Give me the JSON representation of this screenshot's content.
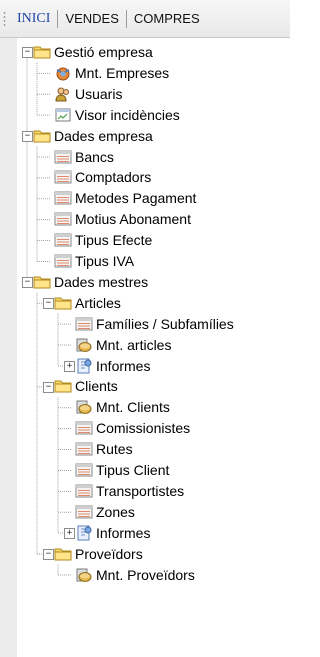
{
  "tabs": [
    {
      "label": "INICI",
      "active": true
    },
    {
      "label": "VENDES",
      "active": false
    },
    {
      "label": "COMPRES",
      "active": false
    }
  ],
  "tree": [
    {
      "label": "Gestió empresa",
      "icon": "folder-icon",
      "level": 0,
      "expander": "−"
    },
    {
      "label": "Mnt. Empreses",
      "icon": "company-icon",
      "level": 1
    },
    {
      "label": "Usuaris",
      "icon": "users-icon",
      "level": 1
    },
    {
      "label": "Visor incidències",
      "icon": "viewer-icon",
      "level": 1
    },
    {
      "label": "Dades empresa",
      "icon": "folder-icon",
      "level": 0,
      "expander": "−"
    },
    {
      "label": "Bancs",
      "icon": "list-icon",
      "level": 1
    },
    {
      "label": "Comptadors",
      "icon": "list-icon",
      "level": 1
    },
    {
      "label": "Metodes Pagament",
      "icon": "list-icon",
      "level": 1
    },
    {
      "label": "Motius Abonament",
      "icon": "list-icon",
      "level": 1
    },
    {
      "label": "Tipus Efecte",
      "icon": "list-icon",
      "level": 1
    },
    {
      "label": "Tipus IVA",
      "icon": "list-icon",
      "level": 1
    },
    {
      "label": "Dades mestres",
      "icon": "folder-icon",
      "level": 0,
      "expander": "−"
    },
    {
      "label": "Articles",
      "icon": "folder-icon",
      "level": 1,
      "expander": "−"
    },
    {
      "label": "Famílies / Subfamílies",
      "icon": "list-icon",
      "level": 2
    },
    {
      "label": "Mnt. articles",
      "icon": "database-icon",
      "level": 2
    },
    {
      "label": "Informes",
      "icon": "report-icon",
      "level": 2,
      "expander": "+"
    },
    {
      "label": "Clients",
      "icon": "folder-icon",
      "level": 1,
      "expander": "−"
    },
    {
      "label": "Mnt. Clients",
      "icon": "database-icon",
      "level": 2
    },
    {
      "label": "Comissionistes",
      "icon": "list-icon",
      "level": 2
    },
    {
      "label": "Rutes",
      "icon": "list-icon",
      "level": 2
    },
    {
      "label": "Tipus Client",
      "icon": "list-icon",
      "level": 2
    },
    {
      "label": "Transportistes",
      "icon": "list-icon",
      "level": 2
    },
    {
      "label": "Zones",
      "icon": "list-icon",
      "level": 2
    },
    {
      "label": "Informes",
      "icon": "report-icon",
      "level": 2,
      "expander": "+"
    },
    {
      "label": "Proveïdors",
      "icon": "folder-icon",
      "level": 1,
      "expander": "−"
    },
    {
      "label": "Mnt. Proveïdors",
      "icon": "database-icon",
      "level": 2
    }
  ]
}
